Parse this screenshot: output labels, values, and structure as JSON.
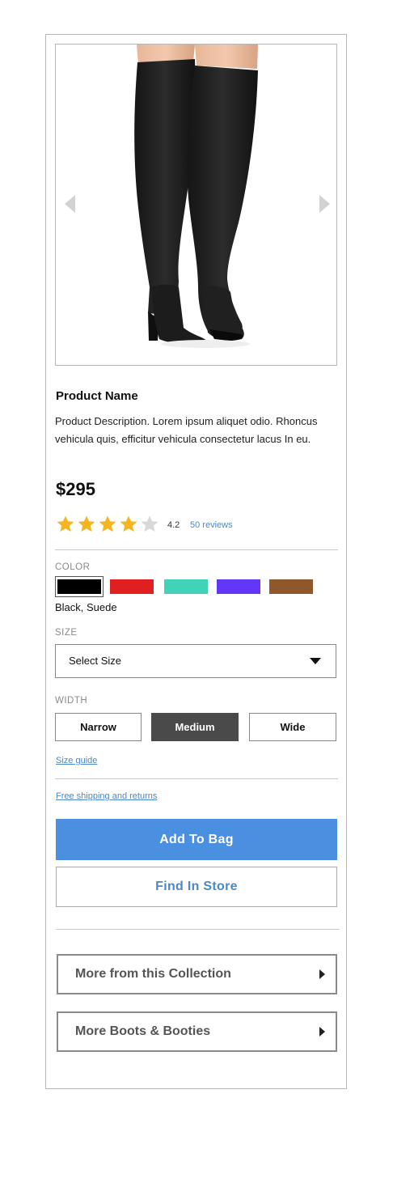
{
  "product": {
    "name": "Product Name",
    "description": "Product Description. Lorem ipsum aliquet odio. Rhoncus vehicula quis, efficitur vehicula consectetur lacus In eu.",
    "price": "$295",
    "rating_value": "4.2",
    "rating_stars": 4,
    "reviews_link": "50 reviews"
  },
  "gallery": {
    "prev_icon": "chevron-left-icon",
    "next_icon": "chevron-right-icon"
  },
  "color": {
    "label": "COLOR",
    "selected_name": "Black, Suede",
    "swatches": [
      "#000000",
      "#e02020",
      "#41d3b7",
      "#6337f7",
      "#8f582c"
    ]
  },
  "size": {
    "label": "SIZE",
    "selected_value": "Select Size"
  },
  "width": {
    "label": "WIDTH",
    "options": [
      "Narrow",
      "Medium",
      "Wide"
    ],
    "selected": "Medium"
  },
  "links": {
    "size_guide": "Size guide",
    "free_shipping": "Free shipping and returns"
  },
  "actions": {
    "add_to_bag": "Add To Bag",
    "find_in_store": "Find In Store"
  },
  "accordions": {
    "collection": "More from this Collection",
    "boots": "More Boots & Booties"
  },
  "colors": {
    "primary": "#4a8fe0",
    "link": "#4a88c7",
    "star": "#f5b521",
    "star_empty": "#d8d8d8",
    "selected_width": "#4a4a4a"
  }
}
